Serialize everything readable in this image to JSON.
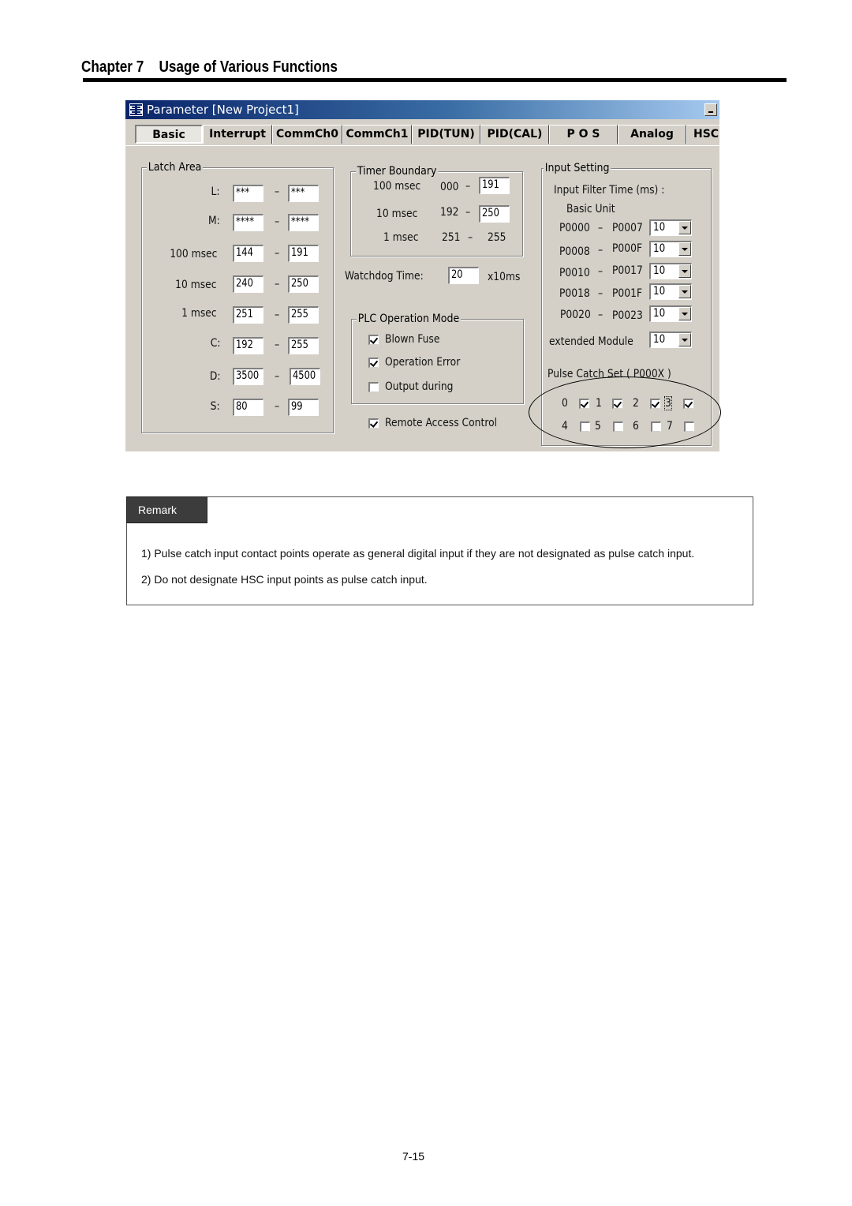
{
  "page": {
    "chapter_title": "Chapter 7    Usage of Various Functions",
    "page_number": "7-15"
  },
  "window": {
    "title": "Parameter [New Project1]",
    "minimize_label": "_",
    "tabs": [
      {
        "label": "Basic",
        "active": true
      },
      {
        "label": "Interrupt",
        "active": false
      },
      {
        "label": "CommCh0",
        "active": false
      },
      {
        "label": "CommCh1",
        "active": false
      },
      {
        "label": "PID(TUN)",
        "active": false
      },
      {
        "label": "PID(CAL)",
        "active": false
      },
      {
        "label": "P O S",
        "active": false
      },
      {
        "label": "Analog",
        "active": false
      },
      {
        "label": "HSC",
        "active": false
      }
    ]
  },
  "latch_area": {
    "title": "Latch Area",
    "separator": "–",
    "rows": [
      {
        "label": "L:",
        "from": "***",
        "to": "***"
      },
      {
        "label": "M:",
        "from": "****",
        "to": "****"
      },
      {
        "label": "100 msec",
        "from": "144",
        "to": "191"
      },
      {
        "label": "10 msec",
        "from": "240",
        "to": "250"
      },
      {
        "label": "1 msec",
        "from": "251",
        "to": "255"
      },
      {
        "label": "C:",
        "from": "192",
        "to": "255"
      },
      {
        "label": "D:",
        "from": "3500",
        "to": "4500"
      },
      {
        "label": "S:",
        "from": "80",
        "to": "99"
      }
    ]
  },
  "timer_boundary": {
    "title": "Timer Boundary",
    "separator": "–",
    "rows": [
      {
        "label": "100 msec",
        "from": "000",
        "to": "191"
      },
      {
        "label": "10 msec",
        "from": "192",
        "to": "250"
      },
      {
        "label": "1 msec",
        "from": "251",
        "to": "255"
      }
    ]
  },
  "watchdog": {
    "label": "Watchdog Time:",
    "value": "20",
    "unit": "x10ms"
  },
  "plc_operation_mode": {
    "title": "PLC Operation Mode",
    "options": [
      {
        "label": "Blown Fuse",
        "checked": true
      },
      {
        "label": "Operation Error",
        "checked": true
      },
      {
        "label": "Output during",
        "checked": false
      }
    ]
  },
  "remote_access": {
    "label": "Remote Access Control",
    "checked": true
  },
  "input_setting": {
    "title": "Input Setting",
    "filter_label": "Input Filter Time (ms) :",
    "basic_unit_label": "Basic Unit",
    "separator": "–",
    "rows": [
      {
        "from": "P0000",
        "to": "P0007",
        "value": "10"
      },
      {
        "from": "P0008",
        "to": "P000F",
        "value": "10"
      },
      {
        "from": "P0010",
        "to": "P0017",
        "value": "10"
      },
      {
        "from": "P0018",
        "to": "P001F",
        "value": "10"
      },
      {
        "from": "P0020",
        "to": "P0023",
        "value": "10"
      }
    ],
    "extended_label": "extended Module",
    "extended_value": "10"
  },
  "pulse_catch": {
    "title": "Pulse Catch Set ( P000X )",
    "points": [
      {
        "label": "0",
        "checked": true
      },
      {
        "label": "1",
        "checked": true
      },
      {
        "label": "2",
        "checked": true
      },
      {
        "label": "3",
        "checked": true
      },
      {
        "label": "4",
        "checked": false
      },
      {
        "label": "5",
        "checked": false
      },
      {
        "label": "6",
        "checked": false
      },
      {
        "label": "7",
        "checked": false
      }
    ]
  },
  "remark": {
    "title": "Remark",
    "lines": [
      "1) Pulse catch input contact points operate as general digital input if they are not designated as pulse catch input.",
      "2) Do not designate HSC input points as pulse catch input."
    ]
  }
}
